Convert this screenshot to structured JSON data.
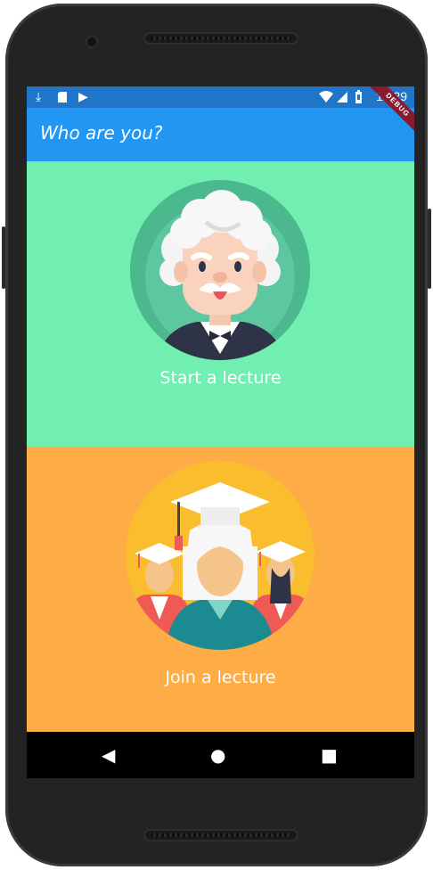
{
  "status_bar": {
    "time": "12:29",
    "debug_banner": "DEBUG"
  },
  "app_bar": {
    "title": "Who are you?"
  },
  "options": [
    {
      "label": "Start a lecture",
      "image": "professor-avatar"
    },
    {
      "label": "Join a lecture",
      "image": "graduates-avatar"
    }
  ],
  "colors": {
    "status_bar": "#1f75c8",
    "app_bar": "#2196f3",
    "start_panel": "#70efb1",
    "join_panel": "#feac45"
  },
  "nav_bar": {
    "icons": [
      "back-icon",
      "home-icon",
      "recents-icon"
    ]
  }
}
